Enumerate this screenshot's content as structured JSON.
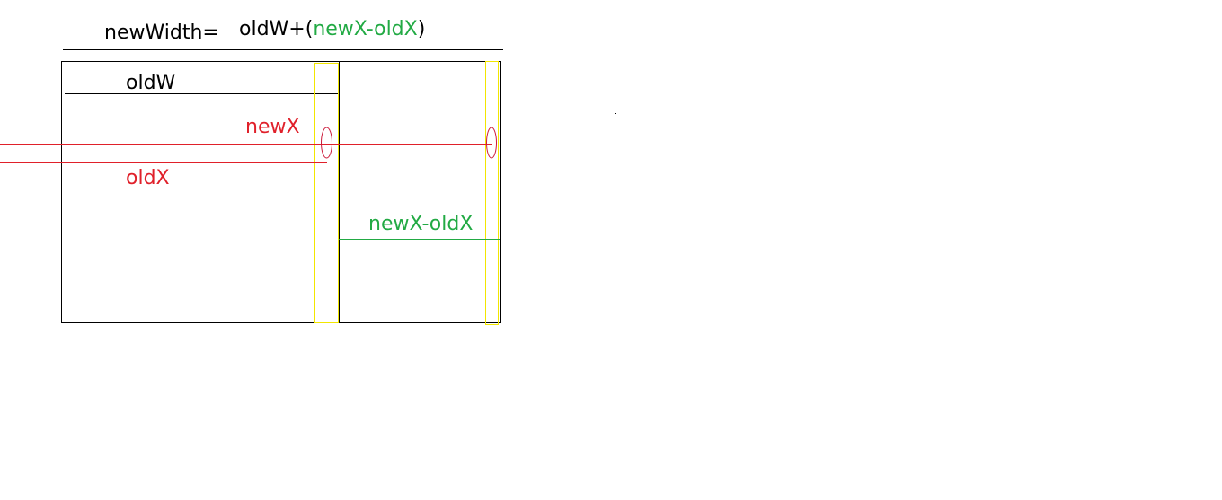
{
  "formula": {
    "lhs": "newWidth=",
    "term_old_w": "oldW+(",
    "term_diff": "newX-oldX",
    "close_paren": ")"
  },
  "labels": {
    "old_w": "oldW",
    "new_x": "newX",
    "old_x": "oldX",
    "diff": "newX-oldX"
  },
  "colors": {
    "stroke": "#000000",
    "position_lines": "#e0202a",
    "difference": "#22aa44",
    "drag_handle": "#f2e600",
    "cursor_marker": "#cc1a3a"
  }
}
